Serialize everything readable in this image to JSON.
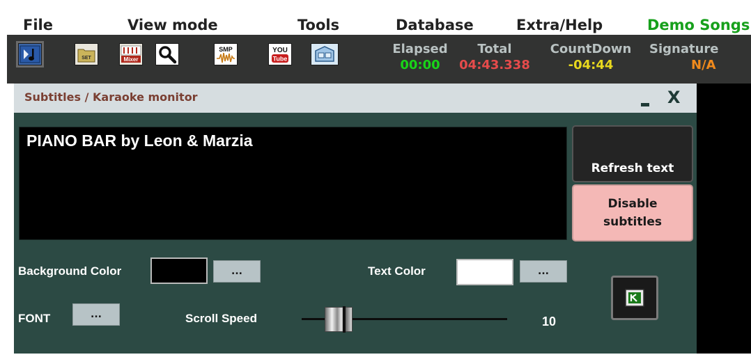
{
  "menu": {
    "file": "File",
    "view_mode": "View mode",
    "tools": "Tools",
    "database": "Database",
    "extra_help": "Extra/Help",
    "demo_songs": "Demo Songs"
  },
  "toolbar": {
    "buttons": [
      {
        "icon": "play-note-icon",
        "active": true
      },
      {
        "icon": "set-icon",
        "label": "SET"
      },
      {
        "icon": "mixer-icon",
        "label": "Mixer"
      },
      {
        "icon": "search-icon"
      },
      {
        "icon": "smp-icon",
        "label": "SMP"
      },
      {
        "icon": "youtube-icon",
        "label_top": "YOU",
        "label_bottom": "Tube"
      },
      {
        "icon": "screens-icon"
      }
    ]
  },
  "counters": {
    "elapsed": {
      "label": "Elapsed",
      "value": "00:00",
      "color": "#19d419"
    },
    "total": {
      "label": "Total",
      "value": "04:43.338",
      "color": "#e64b4b"
    },
    "countdown": {
      "label": "CountDown",
      "value": "-04:44",
      "color": "#e8d81e"
    },
    "signature": {
      "label": "Signature",
      "value": "N/A",
      "color": "#f08a1c"
    }
  },
  "monitor": {
    "title": "Subtitles / Karaoke monitor",
    "minimize_label": "_",
    "close_label": "X",
    "subtitle_text": "PIANO BAR by Leon & Marzia",
    "refresh_label": "Refresh text",
    "disable_line1": "Disable",
    "disable_line2": "subtitles",
    "background_color_label": "Background Color",
    "background_color_value": "#000000",
    "text_color_label": "Text Color",
    "text_color_value": "#ffffff",
    "font_label": "FONT",
    "dots_label": "...",
    "scroll_speed_label": "Scroll Speed",
    "scroll_speed_value": "10",
    "scroll_speed_fraction": 0.18
  }
}
